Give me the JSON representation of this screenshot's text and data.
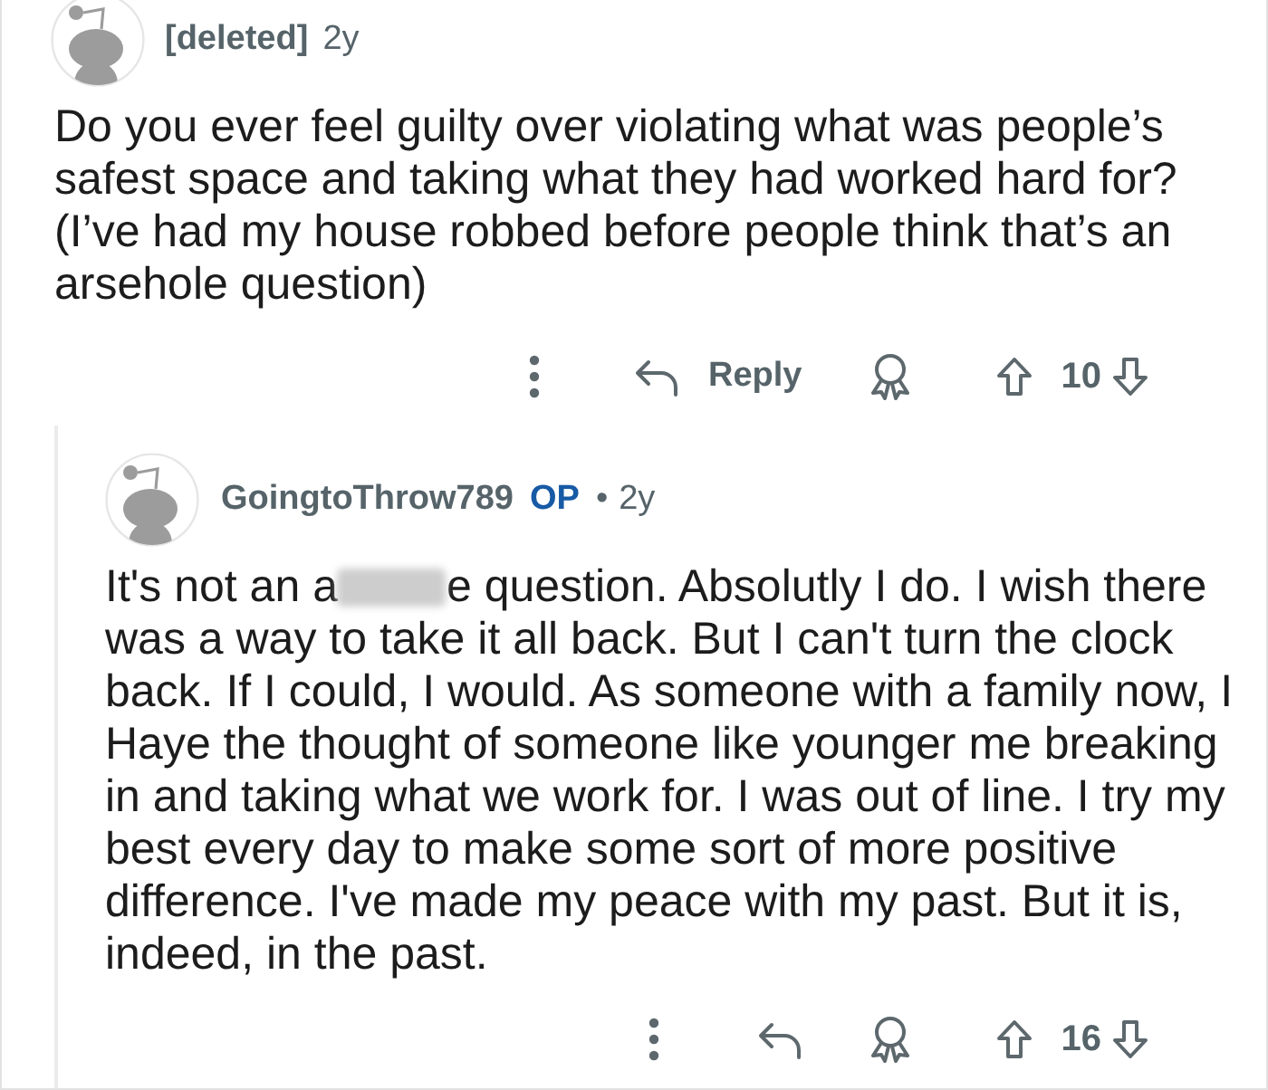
{
  "comments": [
    {
      "author": "[deleted]",
      "age": "2y",
      "body": [
        {
          "kind": "text",
          "text": "Do you ever feel guilty over violating what was people’s safest space and taking what they had worked hard for? (I’ve had my house robbed before people think that’s an arsehole question)"
        }
      ],
      "reply_label": "Reply",
      "score": "10",
      "replies": [
        {
          "author": "GoingtoThrow789",
          "op_badge": "OP",
          "separator": "•",
          "age": "2y",
          "body": [
            {
              "kind": "text",
              "text": "It's not an a"
            },
            {
              "kind": "blur"
            },
            {
              "kind": "text",
              "text": "e question. Absolutly I do. I wish there was a way to take it all back. But I can't turn the clock back. If I could, I would. As someone with a family now, I Haye the thought of someone like younger me breaking in and taking what we work for. I was out of line. I try my best every day to make some sort of more positive difference. I've made my peace with my past. But it is, indeed, in the past."
            }
          ],
          "score": "16"
        }
      ]
    }
  ]
}
